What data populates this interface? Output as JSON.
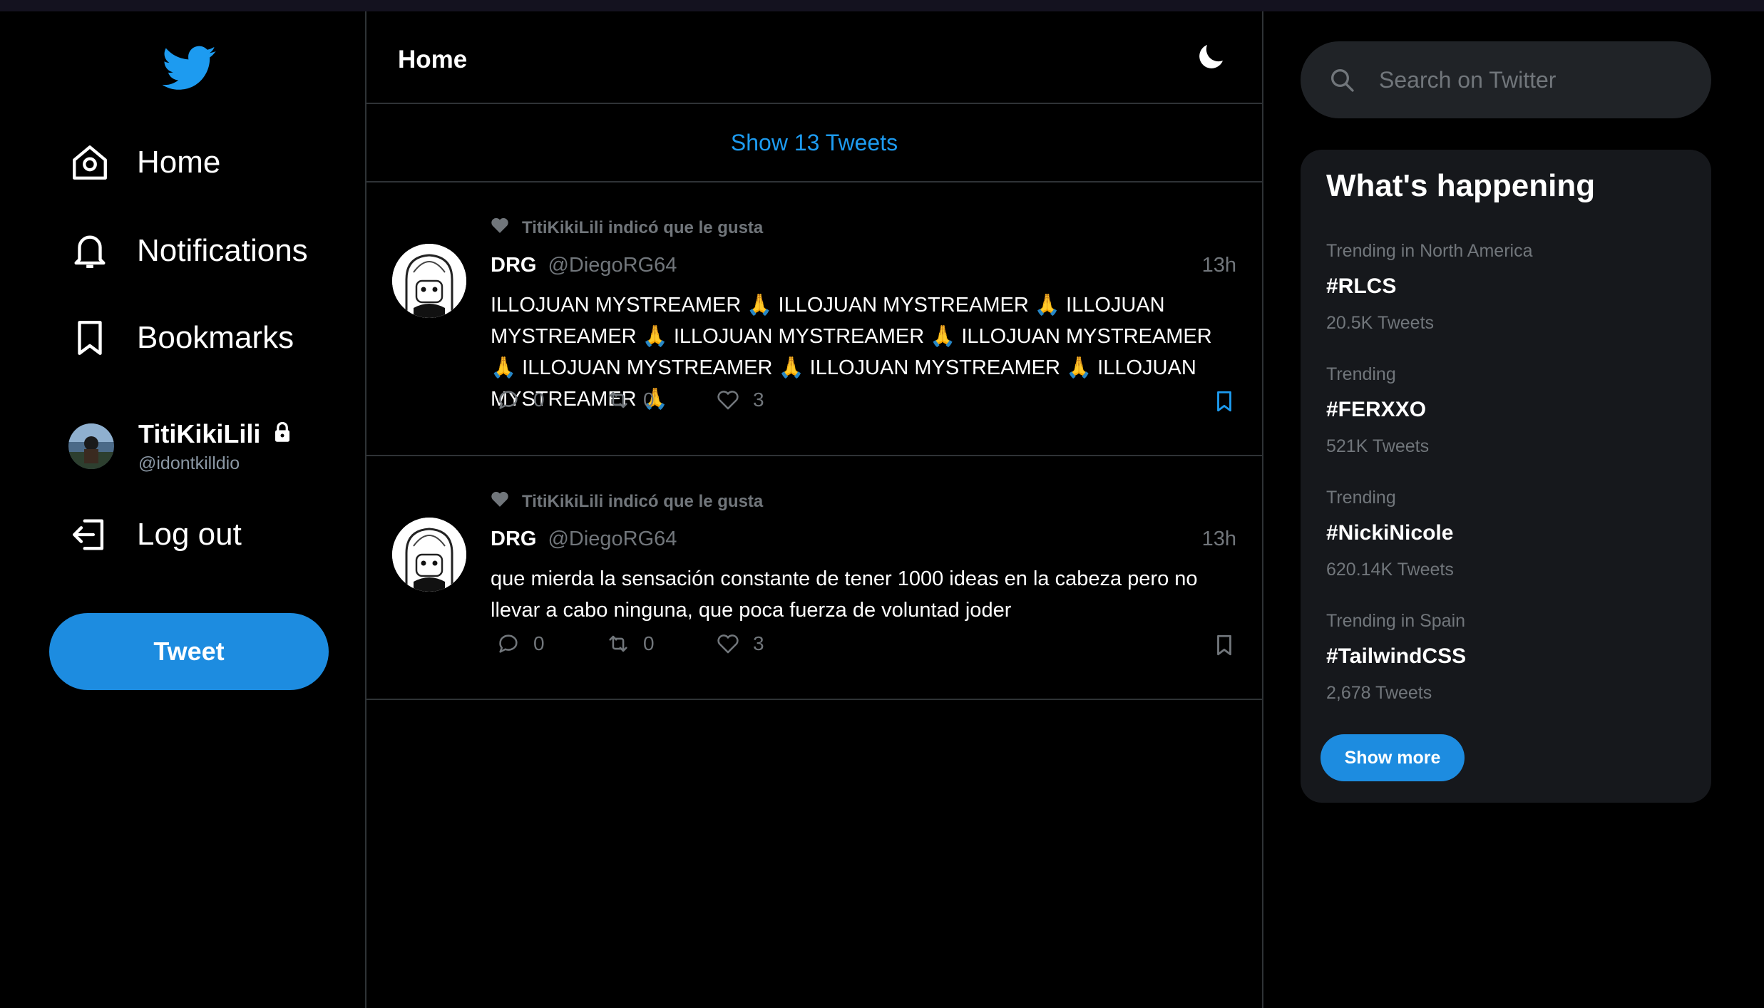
{
  "colors": {
    "accent": "#1d9bf0",
    "button": "#1d8ce0",
    "background": "#000000",
    "panel": "#16181c",
    "muted": "#71767b"
  },
  "sidebar": {
    "logo_icon": "twitter-bird-icon",
    "nav": [
      {
        "label": "Home",
        "icon": "home-icon"
      },
      {
        "label": "Notifications",
        "icon": "bell-icon"
      },
      {
        "label": "Bookmarks",
        "icon": "bookmark-icon"
      }
    ],
    "profile": {
      "name": "TitiKikiLili",
      "handle": "@idontkilldio",
      "locked_icon": "lock-icon"
    },
    "logout_label": "Log out",
    "tweet_button": "Tweet"
  },
  "main": {
    "title": "Home",
    "theme_icon": "moon-icon",
    "show_tweets": "Show 13 Tweets",
    "tweets": [
      {
        "liked_by": "TitiKikiLili indicó que le gusta",
        "name": "DRG",
        "handle": "@DiegoRG64",
        "time": "13h",
        "text": "ILLOJUAN MYSTREAMER 🙏 ILLOJUAN MYSTREAMER 🙏 ILLOJUAN MYSTREAMER 🙏 ILLOJUAN MYSTREAMER 🙏 ILLOJUAN MYSTREAMER 🙏 ILLOJUAN MYSTREAMER 🙏 ILLOJUAN MYSTREAMER 🙏 ILLOJUAN MYSTREAMER 🙏",
        "replies": "0",
        "retweets": "0",
        "likes": "3",
        "bookmarked": true
      },
      {
        "liked_by": "TitiKikiLili indicó que le gusta",
        "name": "DRG",
        "handle": "@DiegoRG64",
        "time": "13h",
        "text": "que mierda la sensación constante de tener 1000 ideas en la cabeza pero no llevar a cabo ninguna, que poca fuerza de voluntad joder",
        "replies": "0",
        "retweets": "0",
        "likes": "3",
        "bookmarked": false
      }
    ]
  },
  "search": {
    "placeholder": "Search on Twitter"
  },
  "trends": {
    "title": "What's happening",
    "items": [
      {
        "context": "Trending in North America",
        "tag": "#RLCS",
        "count": "20.5K Tweets"
      },
      {
        "context": "Trending",
        "tag": "#FERXXO",
        "count": "521K Tweets"
      },
      {
        "context": "Trending",
        "tag": "#NickiNicole",
        "count": "620.14K Tweets"
      },
      {
        "context": "Trending in Spain",
        "tag": "#TailwindCSS",
        "count": "2,678 Tweets"
      }
    ],
    "show_more": "Show more"
  }
}
